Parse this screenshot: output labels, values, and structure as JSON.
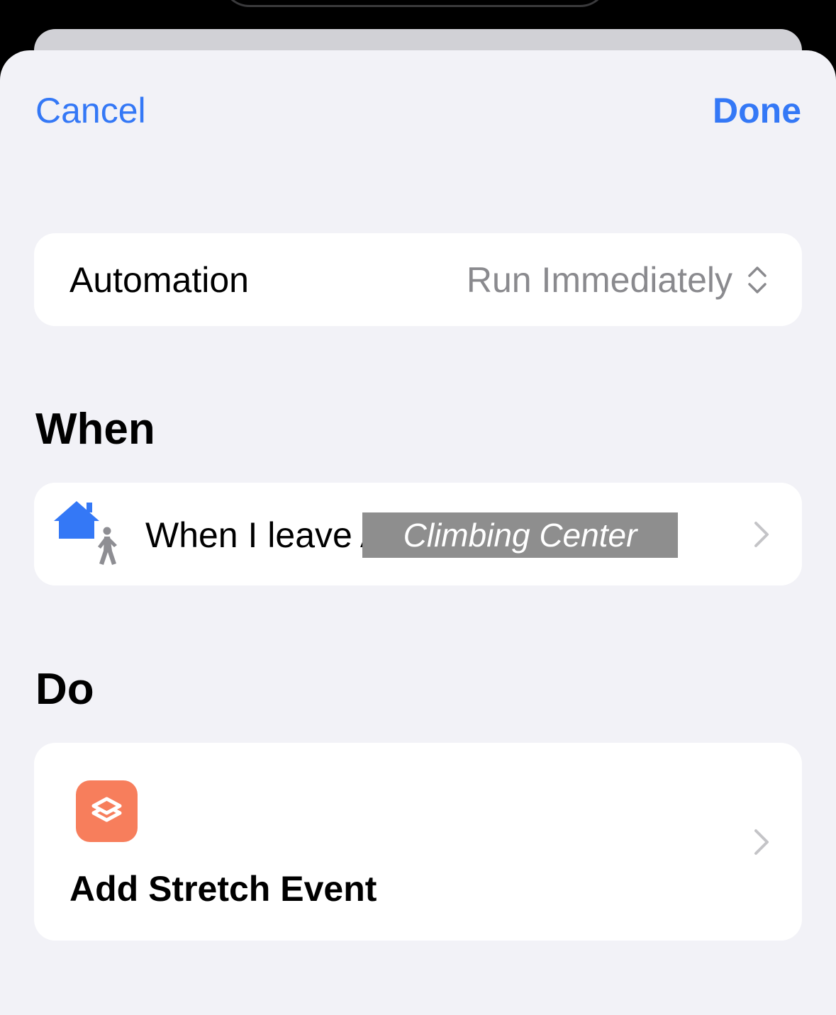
{
  "nav": {
    "cancel_label": "Cancel",
    "done_label": "Done"
  },
  "automation": {
    "label": "Automation",
    "run_mode": "Run Immediately",
    "run_mode_icon": "chevron-up-down-icon"
  },
  "when": {
    "heading": "When",
    "trigger_icon": "leave-home-icon",
    "trigger_text": "When I leave A",
    "location": "Climbing Center",
    "chevron_icon": "chevron-right-icon"
  },
  "do": {
    "heading": "Do",
    "action_icon": "shortcuts-app-icon",
    "action_title": "Add Stretch Event",
    "chevron_icon": "chevron-right-icon"
  },
  "colors": {
    "accent": "#3478f6",
    "sheet_background": "#f2f2f7",
    "card_background": "#ffffff",
    "secondary_text": "#8a8a8e",
    "location_token": "#8e8e8e",
    "shortcuts_icon": "#f77e5c"
  }
}
